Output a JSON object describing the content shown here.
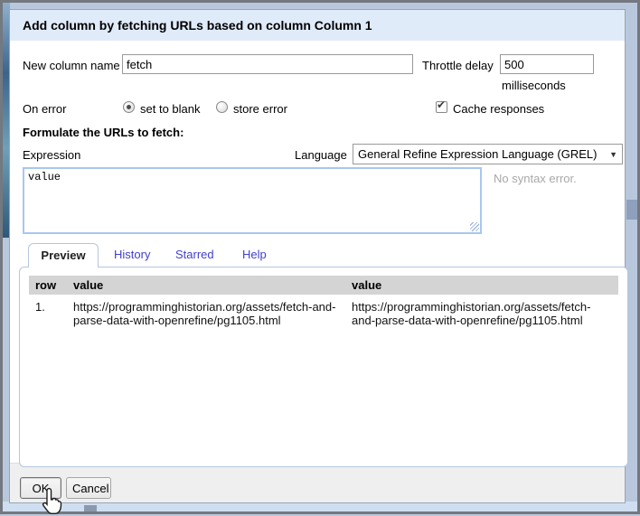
{
  "dialog": {
    "title": "Add column by fetching URLs based on column Column 1",
    "new_column": {
      "label": "New column name",
      "value": "fetch"
    },
    "throttle": {
      "label": "Throttle delay",
      "value": "500",
      "unit": "milliseconds"
    },
    "on_error": {
      "label": "On error",
      "set_to_blank": "set to blank",
      "store_error": "store error"
    },
    "cache": {
      "label": "Cache responses"
    },
    "formulate_heading": "Formulate the URLs to fetch:",
    "expression": {
      "label": "Expression",
      "value": "value",
      "status": "No syntax error."
    },
    "language": {
      "label": "Language",
      "selected": "General Refine Expression Language (GREL)"
    },
    "tabs": {
      "preview": "Preview",
      "history": "History",
      "starred": "Starred",
      "help": "Help"
    },
    "table": {
      "headers": {
        "row": "row",
        "value1": "value",
        "value2": "value"
      },
      "rows": [
        {
          "num": "1.",
          "value1": "https://programminghistorian.org/assets/fetch-and-parse-data-with-openrefine/pg1105.html",
          "value2": "https://programminghistorian.org/assets/fetch-and-parse-data-with-openrefine/pg1105.html"
        }
      ]
    },
    "buttons": {
      "ok": "OK",
      "cancel": "Cancel"
    }
  },
  "icons": {
    "dropdown_arrow": "▼",
    "checkmark": "✔"
  },
  "colors": {
    "title_bar": "#e0ebfa",
    "link": "#4141cd",
    "table_header_bg": "#d4d4d4",
    "expression_focus_border": "#a9c7ee",
    "footer_bg": "#efefef"
  }
}
